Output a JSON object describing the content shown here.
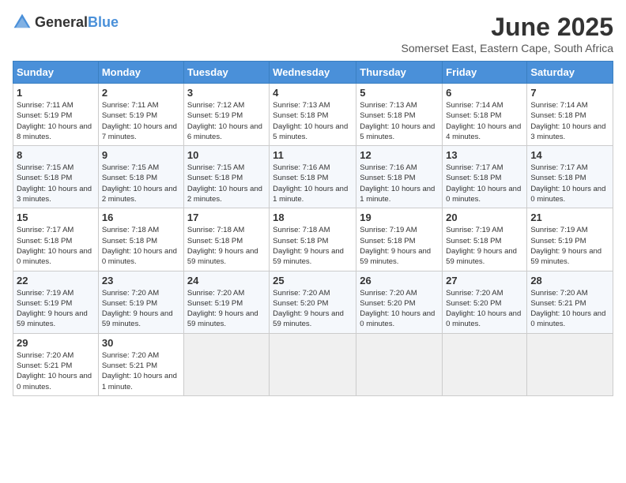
{
  "logo": {
    "general": "General",
    "blue": "Blue"
  },
  "title": "June 2025",
  "subtitle": "Somerset East, Eastern Cape, South Africa",
  "days_header": [
    "Sunday",
    "Monday",
    "Tuesday",
    "Wednesday",
    "Thursday",
    "Friday",
    "Saturday"
  ],
  "weeks": [
    [
      {
        "day": "1",
        "sunrise": "7:11 AM",
        "sunset": "5:19 PM",
        "daylight": "10 hours and 8 minutes."
      },
      {
        "day": "2",
        "sunrise": "7:11 AM",
        "sunset": "5:19 PM",
        "daylight": "10 hours and 7 minutes."
      },
      {
        "day": "3",
        "sunrise": "7:12 AM",
        "sunset": "5:19 PM",
        "daylight": "10 hours and 6 minutes."
      },
      {
        "day": "4",
        "sunrise": "7:13 AM",
        "sunset": "5:18 PM",
        "daylight": "10 hours and 5 minutes."
      },
      {
        "day": "5",
        "sunrise": "7:13 AM",
        "sunset": "5:18 PM",
        "daylight": "10 hours and 5 minutes."
      },
      {
        "day": "6",
        "sunrise": "7:14 AM",
        "sunset": "5:18 PM",
        "daylight": "10 hours and 4 minutes."
      },
      {
        "day": "7",
        "sunrise": "7:14 AM",
        "sunset": "5:18 PM",
        "daylight": "10 hours and 3 minutes."
      }
    ],
    [
      {
        "day": "8",
        "sunrise": "7:15 AM",
        "sunset": "5:18 PM",
        "daylight": "10 hours and 3 minutes."
      },
      {
        "day": "9",
        "sunrise": "7:15 AM",
        "sunset": "5:18 PM",
        "daylight": "10 hours and 2 minutes."
      },
      {
        "day": "10",
        "sunrise": "7:15 AM",
        "sunset": "5:18 PM",
        "daylight": "10 hours and 2 minutes."
      },
      {
        "day": "11",
        "sunrise": "7:16 AM",
        "sunset": "5:18 PM",
        "daylight": "10 hours and 1 minute."
      },
      {
        "day": "12",
        "sunrise": "7:16 AM",
        "sunset": "5:18 PM",
        "daylight": "10 hours and 1 minute."
      },
      {
        "day": "13",
        "sunrise": "7:17 AM",
        "sunset": "5:18 PM",
        "daylight": "10 hours and 0 minutes."
      },
      {
        "day": "14",
        "sunrise": "7:17 AM",
        "sunset": "5:18 PM",
        "daylight": "10 hours and 0 minutes."
      }
    ],
    [
      {
        "day": "15",
        "sunrise": "7:17 AM",
        "sunset": "5:18 PM",
        "daylight": "10 hours and 0 minutes."
      },
      {
        "day": "16",
        "sunrise": "7:18 AM",
        "sunset": "5:18 PM",
        "daylight": "10 hours and 0 minutes."
      },
      {
        "day": "17",
        "sunrise": "7:18 AM",
        "sunset": "5:18 PM",
        "daylight": "9 hours and 59 minutes."
      },
      {
        "day": "18",
        "sunrise": "7:18 AM",
        "sunset": "5:18 PM",
        "daylight": "9 hours and 59 minutes."
      },
      {
        "day": "19",
        "sunrise": "7:19 AM",
        "sunset": "5:18 PM",
        "daylight": "9 hours and 59 minutes."
      },
      {
        "day": "20",
        "sunrise": "7:19 AM",
        "sunset": "5:18 PM",
        "daylight": "9 hours and 59 minutes."
      },
      {
        "day": "21",
        "sunrise": "7:19 AM",
        "sunset": "5:19 PM",
        "daylight": "9 hours and 59 minutes."
      }
    ],
    [
      {
        "day": "22",
        "sunrise": "7:19 AM",
        "sunset": "5:19 PM",
        "daylight": "9 hours and 59 minutes."
      },
      {
        "day": "23",
        "sunrise": "7:20 AM",
        "sunset": "5:19 PM",
        "daylight": "9 hours and 59 minutes."
      },
      {
        "day": "24",
        "sunrise": "7:20 AM",
        "sunset": "5:19 PM",
        "daylight": "9 hours and 59 minutes."
      },
      {
        "day": "25",
        "sunrise": "7:20 AM",
        "sunset": "5:20 PM",
        "daylight": "9 hours and 59 minutes."
      },
      {
        "day": "26",
        "sunrise": "7:20 AM",
        "sunset": "5:20 PM",
        "daylight": "10 hours and 0 minutes."
      },
      {
        "day": "27",
        "sunrise": "7:20 AM",
        "sunset": "5:20 PM",
        "daylight": "10 hours and 0 minutes."
      },
      {
        "day": "28",
        "sunrise": "7:20 AM",
        "sunset": "5:21 PM",
        "daylight": "10 hours and 0 minutes."
      }
    ],
    [
      {
        "day": "29",
        "sunrise": "7:20 AM",
        "sunset": "5:21 PM",
        "daylight": "10 hours and 0 minutes."
      },
      {
        "day": "30",
        "sunrise": "7:20 AM",
        "sunset": "5:21 PM",
        "daylight": "10 hours and 1 minute."
      },
      null,
      null,
      null,
      null,
      null
    ]
  ],
  "labels": {
    "sunrise": "Sunrise:",
    "sunset": "Sunset:",
    "daylight": "Daylight:"
  }
}
